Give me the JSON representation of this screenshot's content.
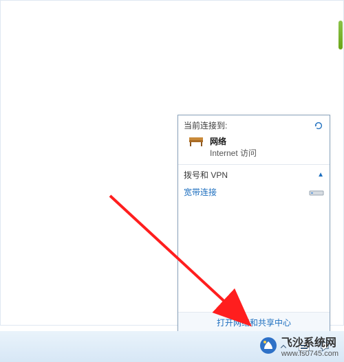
{
  "panel": {
    "header": "当前连接到:",
    "network_name": "网络",
    "network_sub": "Internet 访问",
    "dial_header": "拨号和 VPN",
    "dial_item": "宽带连接",
    "open_center": "打开网络和共享中心"
  },
  "icons": {
    "refresh": "refresh-icon",
    "bench": "bench-icon",
    "modem": "modem-icon",
    "caret": "caret-up-icon",
    "ime": "ime-icon",
    "network": "network-icon",
    "flag": "action-center-icon"
  },
  "watermark": {
    "title": "飞沙系统网",
    "url": "www.fs0745.com"
  },
  "colors": {
    "link": "#1e6fbf",
    "panel_border": "#8aa3bd",
    "taskbar_top": "#e9f3fb",
    "taskbar_bottom": "#d7e7f6",
    "arrow": "#ff1e1e"
  }
}
